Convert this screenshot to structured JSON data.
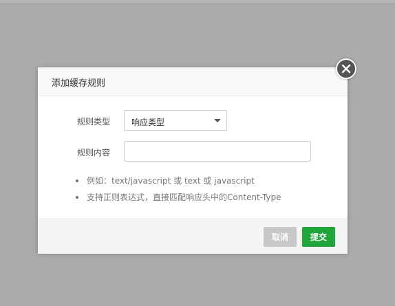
{
  "dialog": {
    "title": "添加缓存规则",
    "close_icon": "close-icon"
  },
  "form": {
    "rule_type_label": "规则类型",
    "rule_type_value": "响应类型",
    "rule_content_label": "规则内容",
    "rule_content_value": "",
    "rule_content_placeholder": ""
  },
  "tips": [
    "例如：text/javascript 或 text 或 javascript",
    "支持正则表达式，直接匹配响应头中的Content-Type"
  ],
  "footer": {
    "cancel_label": "取消",
    "submit_label": "提交"
  },
  "colors": {
    "overlay": "#ababab",
    "submit": "#20a53a",
    "cancel": "#c8c8c8",
    "close_button": "#555555"
  }
}
